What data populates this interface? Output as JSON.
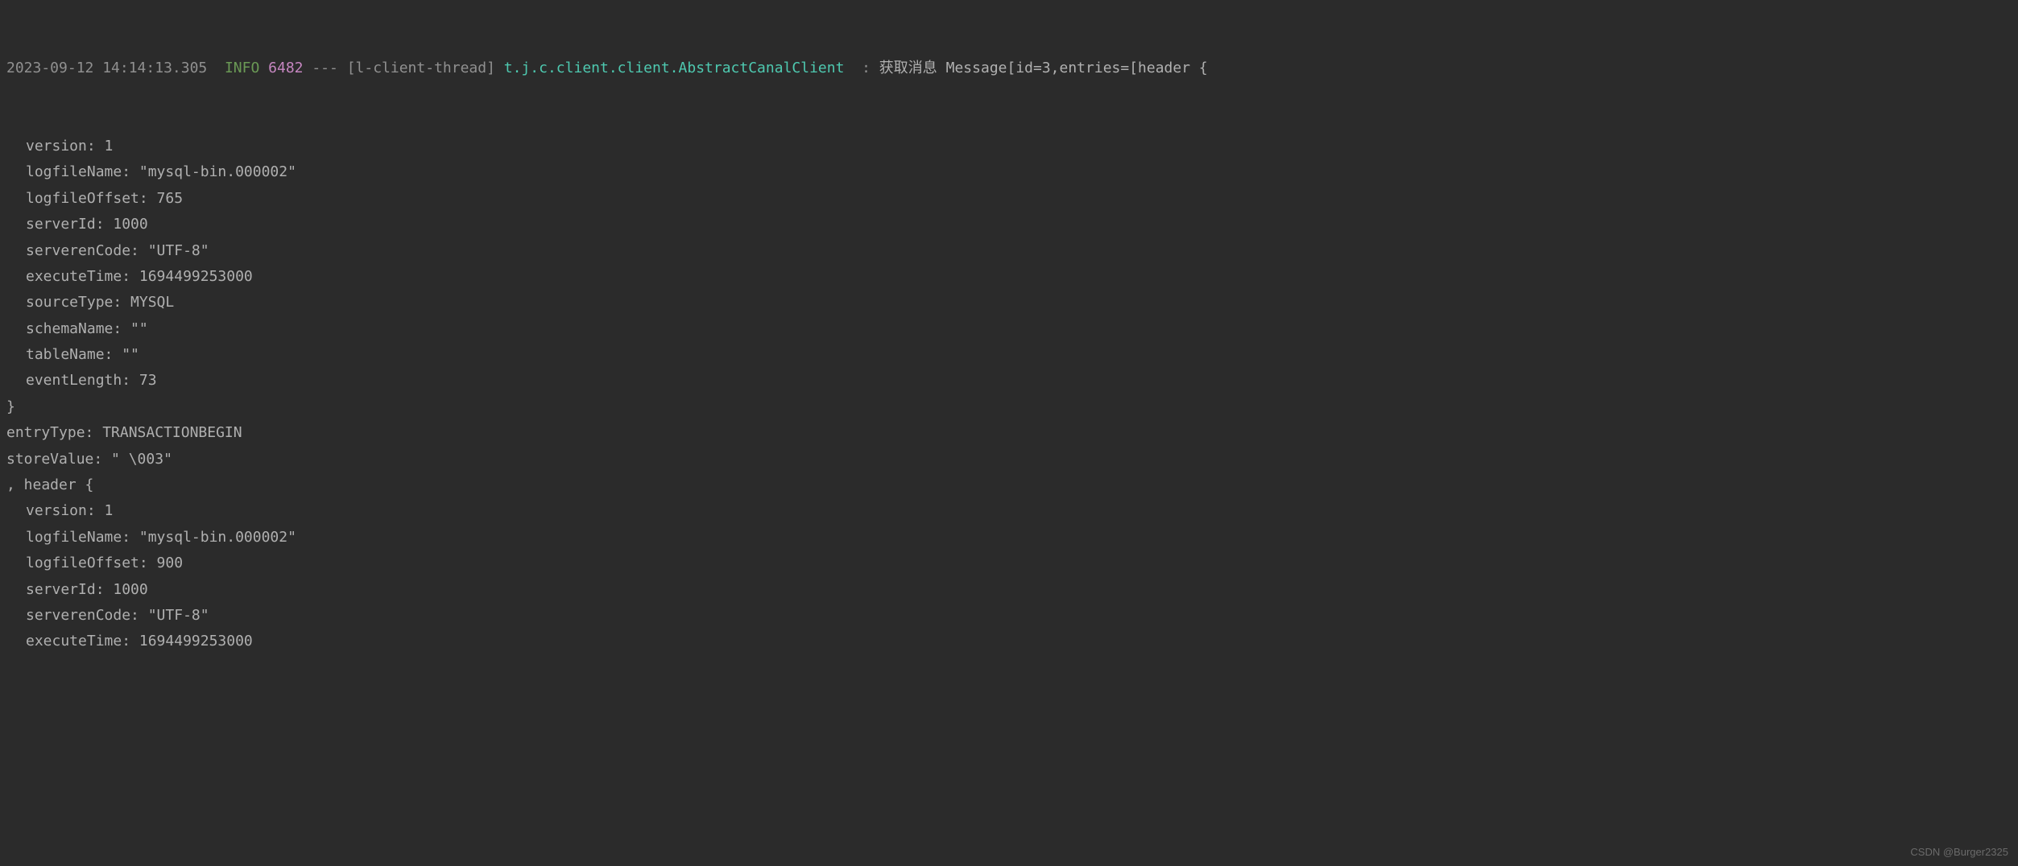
{
  "header": {
    "timestamp": "2023-09-12 14:14:13.305",
    "level": "INFO",
    "pid": "6482",
    "separator": "---",
    "thread": "[l-client-thread]",
    "logger": "t.j.c.client.client.AbstractCanalClient",
    "colon": ":",
    "message_prefix": "获取消息 Message[id=3,entries=[header {"
  },
  "lines": [
    {
      "indent": true,
      "text": "version: 1"
    },
    {
      "indent": true,
      "text": "logfileName: \"mysql-bin.000002\""
    },
    {
      "indent": true,
      "text": "logfileOffset: 765"
    },
    {
      "indent": true,
      "text": "serverId: 1000"
    },
    {
      "indent": true,
      "text": "serverenCode: \"UTF-8\""
    },
    {
      "indent": true,
      "text": "executeTime: 1694499253000"
    },
    {
      "indent": true,
      "text": "sourceType: MYSQL"
    },
    {
      "indent": true,
      "text": "schemaName: \"\""
    },
    {
      "indent": true,
      "text": "tableName: \"\""
    },
    {
      "indent": true,
      "text": "eventLength: 73"
    },
    {
      "indent": false,
      "text": "}"
    },
    {
      "indent": false,
      "text": "entryType: TRANSACTIONBEGIN"
    },
    {
      "indent": false,
      "text": "storeValue: \" \\003\""
    },
    {
      "indent": false,
      "text": ", header {"
    },
    {
      "indent": true,
      "text": "version: 1"
    },
    {
      "indent": true,
      "text": "logfileName: \"mysql-bin.000002\""
    },
    {
      "indent": true,
      "text": "logfileOffset: 900"
    },
    {
      "indent": true,
      "text": "serverId: 1000"
    },
    {
      "indent": true,
      "text": "serverenCode: \"UTF-8\""
    },
    {
      "indent": true,
      "text": "executeTime: 1694499253000"
    }
  ],
  "watermark": "CSDN @Burger2325"
}
